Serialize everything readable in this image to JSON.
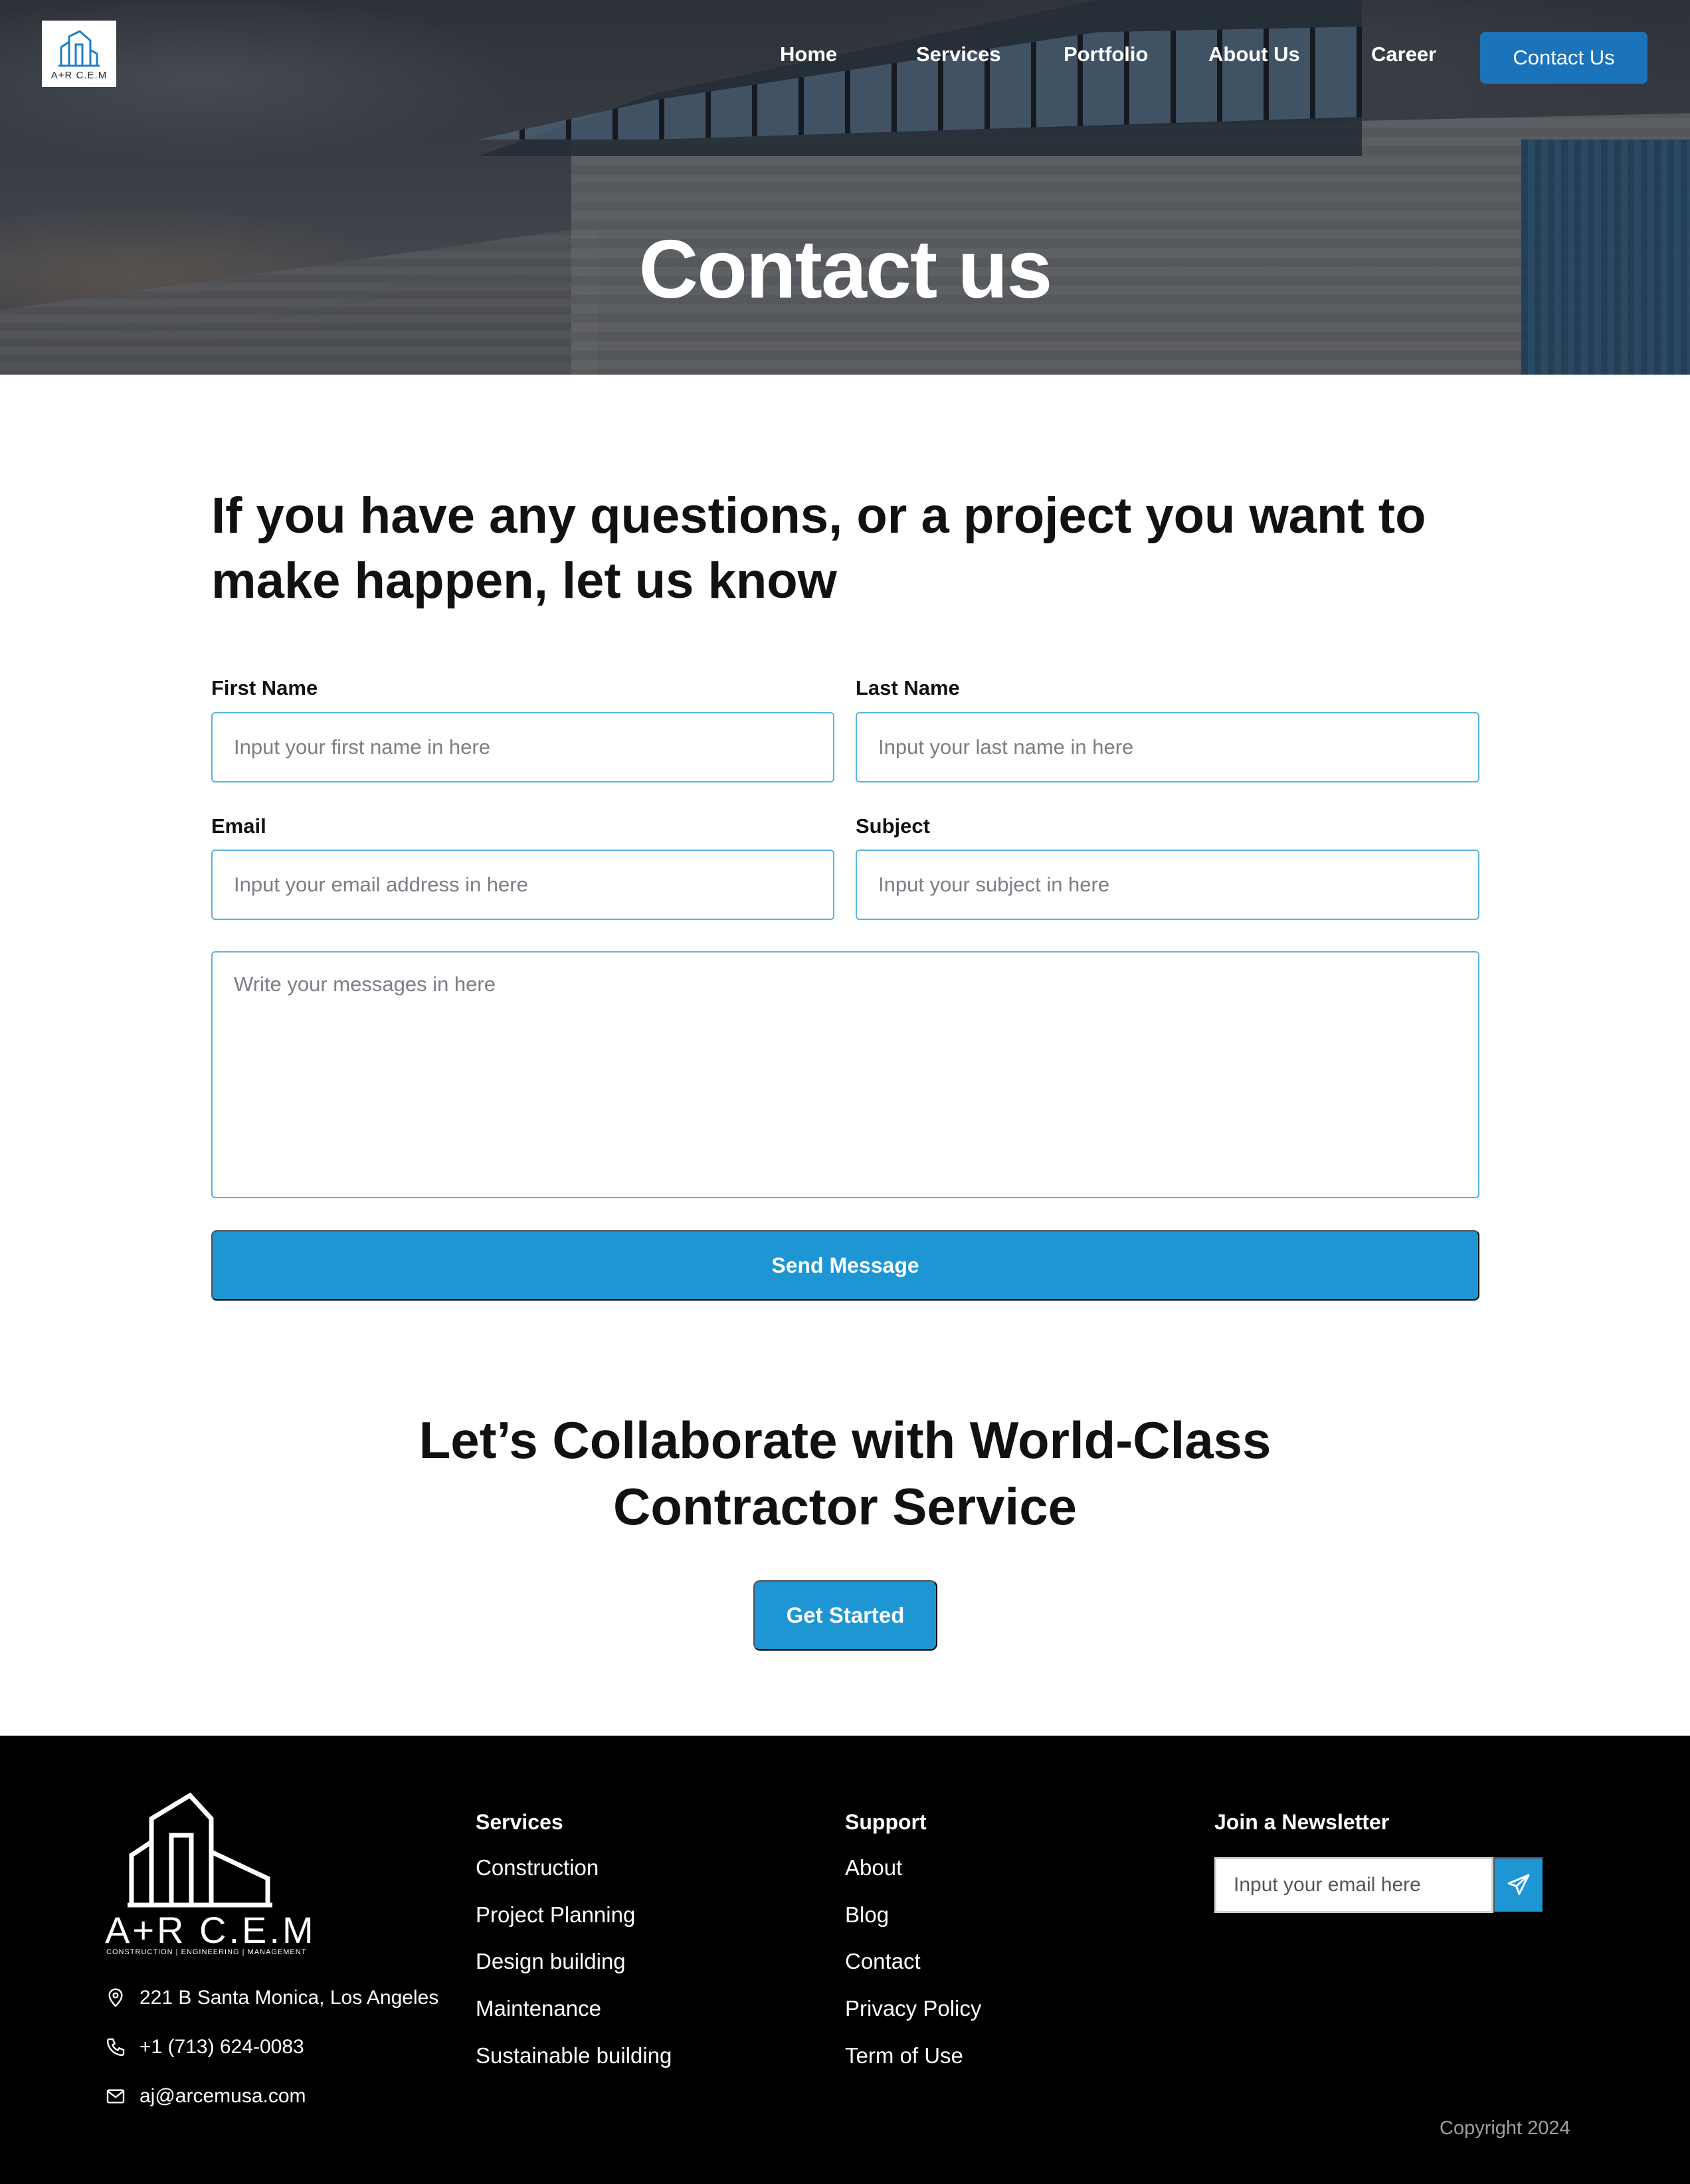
{
  "brand": {
    "logo_text": "A+R C.E.M",
    "tagline": "CONSTRUCTION | ENGINEERING | MANAGEMENT"
  },
  "nav": {
    "items": [
      "Home",
      "Services",
      "Portfolio",
      "About Us",
      "Career"
    ],
    "cta": "Contact Us"
  },
  "hero": {
    "title": "Contact us"
  },
  "form": {
    "intro": "If you have any questions, or a project you want to make happen, let us know",
    "first_name": {
      "label": "First Name",
      "placeholder": "Input your first name in here"
    },
    "last_name": {
      "label": "Last Name",
      "placeholder": "Input your last name in here"
    },
    "email": {
      "label": "Email",
      "placeholder": "Input your email address in here"
    },
    "subject": {
      "label": "Subject",
      "placeholder": "Input your subject in here"
    },
    "message": {
      "placeholder": "Write your messages in here"
    },
    "submit": "Send Message"
  },
  "collab": {
    "line1": "Let’s Collaborate with World-Class",
    "line2": "Contractor Service",
    "cta": "Get Started"
  },
  "footer": {
    "address": "221 B Santa Monica, Los Angeles",
    "phone": "+1 (713) 624-0083",
    "email": "aj@arcemusa.com",
    "services": {
      "heading": "Services",
      "items": [
        "Construction",
        "Project Planning",
        "Design building",
        "Maintenance",
        "Sustainable building"
      ]
    },
    "support": {
      "heading": "Support",
      "items": [
        "About",
        "Blog",
        "Contact",
        "Privacy Policy",
        "Term of Use"
      ]
    },
    "newsletter": {
      "heading": "Join a Newsletter",
      "placeholder": "Input your email here"
    },
    "copyright": "Copyright 2024"
  },
  "colors": {
    "accent": "#1d96d3",
    "nav_cta": "#1b73b9",
    "input_border": "#5ab3dc",
    "footer_bg": "#000000"
  }
}
